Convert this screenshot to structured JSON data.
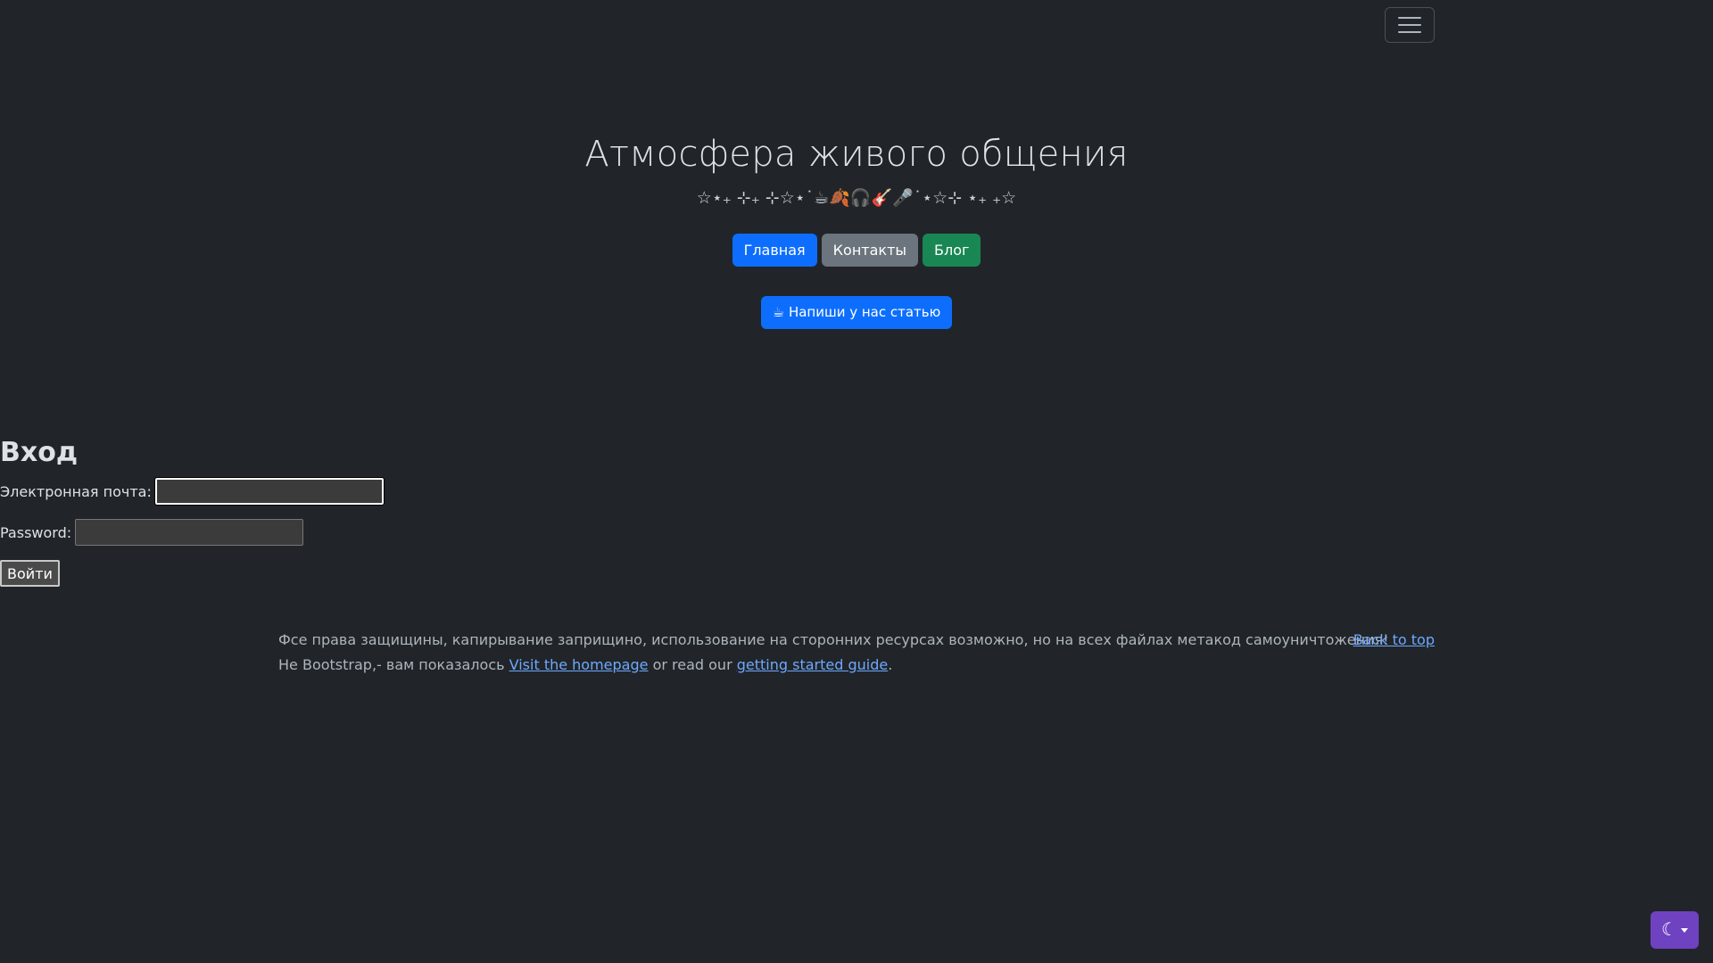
{
  "navbar": {
    "toggler_icon": "hamburger-menu-icon"
  },
  "hero": {
    "title": "Атмосфера живого общения",
    "subtitle": "☆⋆₊ ⊹₊ ⊹☆⋆˙☕🍂🎧🎸🎤˙⋆☆⊹ ⋆₊ ₊☆",
    "buttons": {
      "home": "Главная",
      "contacts": "Контакты",
      "blog": "Блог"
    },
    "write_button": "☕ Напиши у нас статью"
  },
  "login": {
    "title": "Вход",
    "email_label": "Электронная почта:",
    "email_value": "",
    "password_label": "Password:",
    "password_value": "",
    "submit": "Войти"
  },
  "footer": {
    "copyright": "Фсе права защищины, капирывание заприщино, использование на сторонних ресурсах возможно, но на всех файлах метакод самоуничтожения!",
    "line2_prefix": "Не Bootstrap,- вам показалось ",
    "homepage_link": "Visit the homepage",
    "line2_middle": " or read our ",
    "guide_link": "getting started guide",
    "line2_suffix": ".",
    "back_to_top": "Back to top"
  },
  "theme_toggle": {
    "icon": "moon-icon",
    "caret": "caret-down-icon"
  },
  "colors": {
    "background": "#212529",
    "primary": "#0d6efd",
    "secondary": "#6c757d",
    "success": "#198754",
    "link": "#6ea8fe",
    "theme_button": "#6f42c1"
  }
}
